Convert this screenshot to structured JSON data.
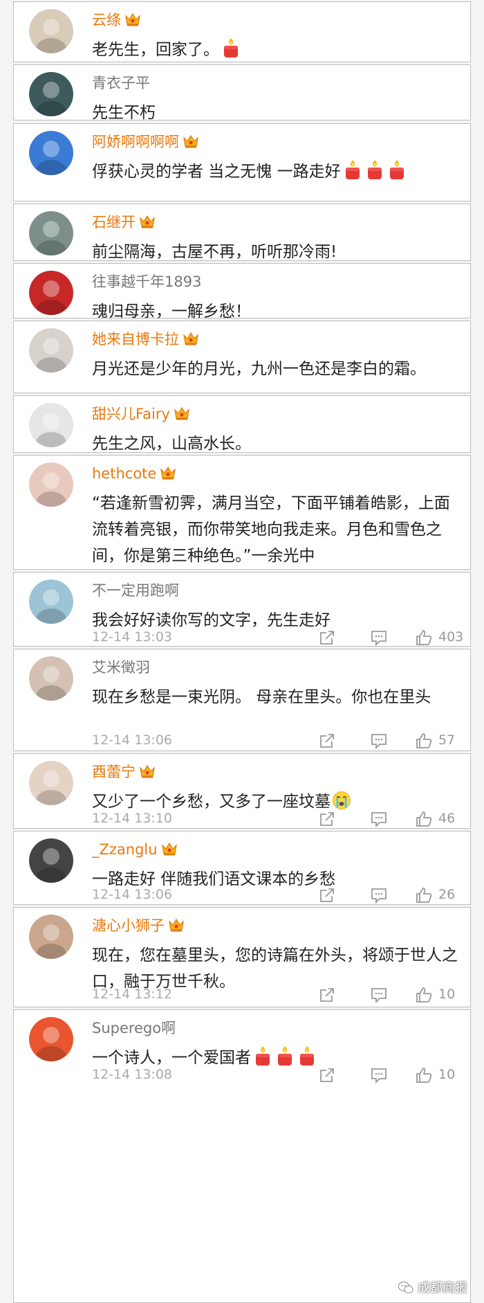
{
  "watermark": {
    "text": "成都商报"
  },
  "comments": [
    {
      "id": 0,
      "user": "云绦",
      "vip": true,
      "text": "老先生，回家了。",
      "candles": 1,
      "av": "#d8cbb8"
    },
    {
      "id": 1,
      "user": "青衣子平",
      "vip": false,
      "text": "先生不朽",
      "candles": 0,
      "av": "#3e5a5c"
    },
    {
      "id": 2,
      "user": "阿娇啊啊啊啊",
      "vip": true,
      "text": "俘获心灵的学者  当之无愧  一路走好",
      "candles": 3,
      "av": "#3a7bd5"
    },
    {
      "id": 3,
      "user": "石继开",
      "vip": true,
      "text": "前尘隔海，古屋不再，听听那冷雨!",
      "candles": 0,
      "av": "#7c8f8a"
    },
    {
      "id": 4,
      "user": "往事越千年1893",
      "vip": false,
      "text": "魂归母亲，一解乡愁！",
      "candles": 0,
      "av": "#c62828"
    },
    {
      "id": 5,
      "user": "她来自博卡拉",
      "vip": true,
      "text": "月光还是少年的月光，九州一色还是李白的霜。",
      "candles": 0,
      "av": "#d7d2cc"
    },
    {
      "id": 6,
      "user": "甜兴儿Fairy",
      "vip": true,
      "text": "先生之风，山高水长。",
      "candles": 0,
      "av": "#e6e6e6"
    },
    {
      "id": 7,
      "user": "hethcote",
      "vip": true,
      "text": "“若逢新雪初霁，满月当空，下面平铺着皓影，上面流转着亮银，而你带笑地向我走来。月色和雪色之间，你是第三种绝色。”一余光中",
      "candles": 0,
      "av": "#e8c9bd"
    },
    {
      "id": 8,
      "user": "不一定用跑啊",
      "vip": false,
      "text": "我会好好读你写的文字，先生走好",
      "candles": 0,
      "av": "#9cc3d6",
      "time": "12-14 13:03",
      "likes": "403"
    },
    {
      "id": 9,
      "user": "艾米徵羽",
      "vip": false,
      "text": "现在乡愁是一束光阴。 母亲在里头。你也在里头",
      "candles": 0,
      "av": "#d4c1b3",
      "time": "12-14 13:06",
      "likes": "57"
    },
    {
      "id": 10,
      "user": "酉蕾宁",
      "vip": true,
      "text": "又少了一个乡愁，又多了一座坟墓",
      "candles": 0,
      "cry": true,
      "av": "#e4d2c5",
      "time": "12-14 13:10",
      "likes": "46"
    },
    {
      "id": 11,
      "user": "_Zzanglu",
      "vip": true,
      "text": "一路走好 伴随我们语文课本的乡愁",
      "candles": 0,
      "av": "#444444",
      "time": "12-14 13:06",
      "likes": "26"
    },
    {
      "id": 12,
      "user": "溏心小狮子",
      "vip": true,
      "text": "现在，您在墓里头，您的诗篇在外头，将颂于世人之口，融于万世千秋。",
      "candles": 0,
      "av": "#c9a68d",
      "time": "12-14 13:12",
      "likes": "10"
    },
    {
      "id": 13,
      "user": "Superego啊",
      "vip": false,
      "text": "一个诗人，一个爱国者",
      "candles": 3,
      "av": "#e8552f",
      "time": "12-14 13:08",
      "likes": "10"
    }
  ]
}
